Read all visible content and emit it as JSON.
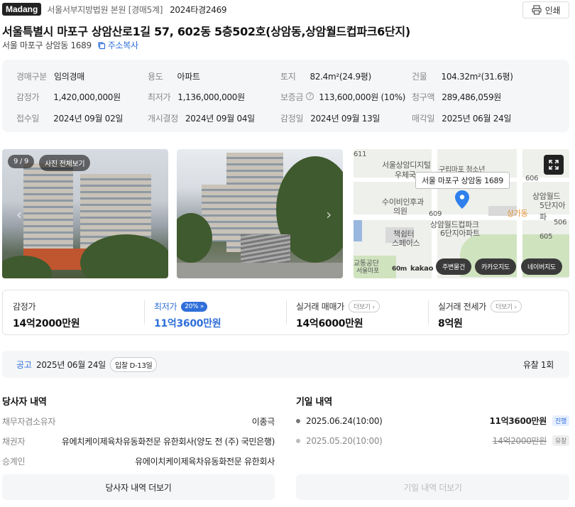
{
  "header": {
    "logo": "Madang",
    "court": "서울서부지방법원 본원 [경매5계]",
    "case_no": "2024타경2469",
    "print_label": "인쇄"
  },
  "title": "서울특별시 마포구 상암산로1길 57, 602동 5층502호(상암동,상암월드컵파크6단지)",
  "address_short": "서울 마포구 상암동 1689",
  "copy_label": "주소복사",
  "info": [
    {
      "label": "경매구분",
      "value": "임의경매"
    },
    {
      "label": "용도",
      "value": "아파트"
    },
    {
      "label": "토지",
      "value": "82.4m²(24.9평)"
    },
    {
      "label": "건물",
      "value": "104.32m²(31.6평)"
    },
    {
      "label": "감정가",
      "value": "1,420,000,000원"
    },
    {
      "label": "최저가",
      "value": "1,136,000,000원"
    },
    {
      "label": "보증금",
      "value": "113,600,000원 (10%)"
    },
    {
      "label": "청구액",
      "value": "289,486,059원"
    },
    {
      "label": "접수일",
      "value": "2024년 09월 02일"
    },
    {
      "label": "개시결정",
      "value": "2024년 09월 04일"
    },
    {
      "label": "감정일",
      "value": "2024년 09월 13일"
    },
    {
      "label": "매각일",
      "value": "2025년 06월 24일"
    }
  ],
  "photos": {
    "counter": "9 / 9",
    "view_all": "사진 전체보기"
  },
  "map": {
    "popup": "서울 마포구 상암동 1689",
    "labels": [
      "서울상암디지털",
      "우체국",
      "수이비인후과",
      "의원",
      "구립마포 청소년",
      "책쉼터",
      "스페이스",
      "상암월드컵파크",
      "6단지아파트",
      "상가동",
      "상암월드",
      "5단지아파",
      "611",
      "609",
      "606",
      "605",
      "506",
      "교통공단",
      "서울마포",
      "60m",
      "kakao"
    ],
    "buttons": [
      "주변물건",
      "카카오지도",
      "네이버지도"
    ]
  },
  "prices": [
    {
      "label": "감정가",
      "value": "14억2000만원"
    },
    {
      "label": "최저가",
      "value": "11억3600만원",
      "badge": "20%"
    },
    {
      "label": "실거래 매매가",
      "value": "14억6000만원",
      "more": "더보기"
    },
    {
      "label": "실거래 전세가",
      "value": "8억원",
      "more": "더보기"
    }
  ],
  "notice": {
    "tag": "공고",
    "date": "2025년 06월 24일",
    "dday": "입찰 D-13일",
    "fail": "유찰 1회"
  },
  "parties": {
    "title": "당사자 내역",
    "rows": [
      {
        "key": "채무자겸소유자",
        "value": "이종극"
      },
      {
        "key": "채권자",
        "value": "유에치케이제육차유동화전문 유한회사(양도 전 (주) 국민은행)"
      },
      {
        "key": "승계인",
        "value": "유에이치케이제육차유동화전문 유한회사"
      }
    ],
    "more": "당사자 내역 더보기"
  },
  "history": {
    "title": "기일 내역",
    "rows": [
      {
        "date": "2025.06.24(10:00)",
        "amount": "11억3600만원",
        "status": "진행"
      },
      {
        "date": "2025.05.20(10:00)",
        "amount": "14억2000만원",
        "status": "유찰"
      }
    ],
    "more": "기일 내역 더보기"
  },
  "colors": {
    "accent": "#2f6fd9",
    "map_pin": "#2f80ed"
  }
}
